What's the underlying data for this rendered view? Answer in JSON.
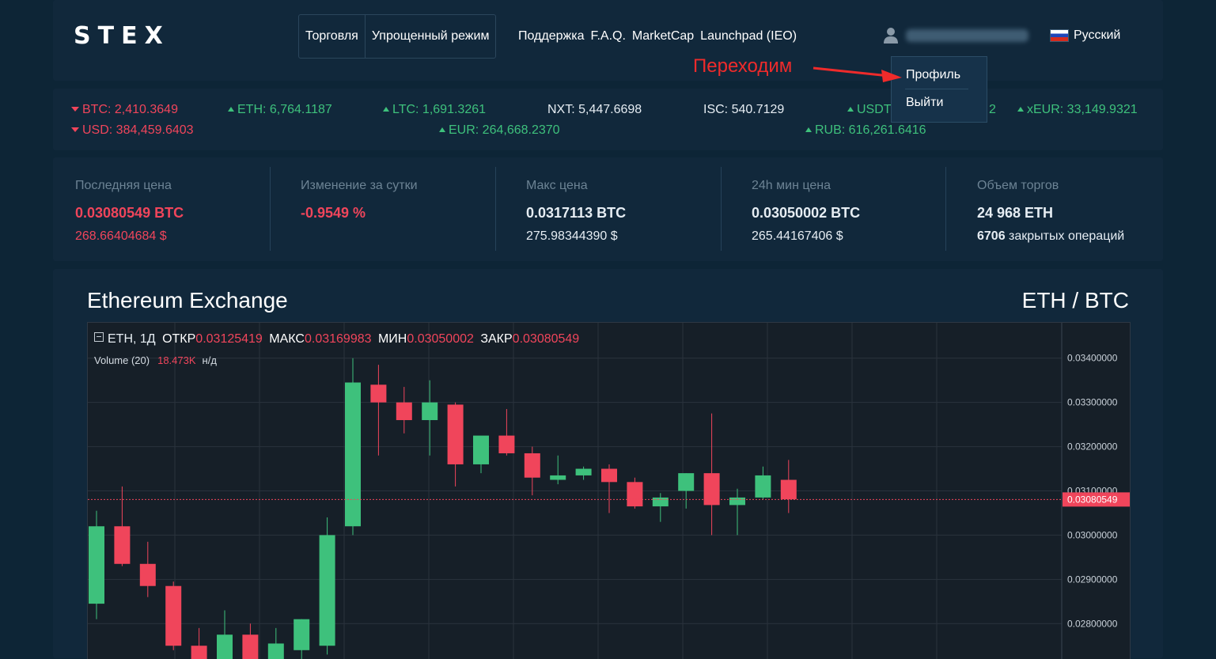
{
  "header": {
    "logo": "STEX",
    "nav_box": [
      "Торговля",
      "Упрощенный режим"
    ],
    "nav_links": [
      "Поддержка",
      "F.A.Q.",
      "MarketCap",
      "Launchpad (IEO)"
    ],
    "language": "Русский",
    "user_menu": {
      "profile": "Профиль",
      "logout": "Выйти"
    }
  },
  "annotation": "Переходим",
  "annotation_color": "#ef2b2b",
  "ticker": {
    "btc": "BTC: 2,410.3649",
    "usd": "USD: 384,459.6403",
    "eth": "ETH: 6,764.1187",
    "ltc": "LTC: 1,691.3261",
    "eur": "EUR: 264,668.2370",
    "nxt": "NXT: 5,447.6698",
    "isc": "ISC: 540.7129",
    "usdt": "USDT",
    "usdt_tail": "2",
    "rub": "RUB: 616,261.6416",
    "xeur": "xEUR: 33,149.9321"
  },
  "stats": [
    {
      "label": "Последняя цена",
      "value": "0.03080549 BTC",
      "sub": "268.66404684 $"
    },
    {
      "label": "Изменение за сутки",
      "value": "-0.9549 %",
      "sub": ""
    },
    {
      "label": "Макс цена",
      "value": "0.0317113 BTC",
      "sub": "275.98344390 $"
    },
    {
      "label": "24h мин цена",
      "value": "0.03050002 BTC",
      "sub": "265.44167406 $"
    },
    {
      "label": "Объем торгов",
      "value": "24 968 ETH",
      "sub_num": "6706",
      "sub_text": " закрытых операций"
    }
  ],
  "chart_panel": {
    "title": "Ethereum Exchange",
    "pair": "ETH / BTC"
  },
  "colors": {
    "up": "#3ec17c",
    "down": "#f0455b",
    "background": "#0d2536",
    "panel": "#11283b",
    "chart_bg": "#161f28"
  },
  "chart_data": {
    "type": "candlestick",
    "symbol": "ETH, 1Д",
    "ohlc_labels": {
      "open": "ОТКР",
      "high": "МАКС",
      "low": "МИН",
      "close": "ЗАКР"
    },
    "ohlc_values": {
      "open": "0.03125419",
      "high": "0.03169983",
      "low": "0.03050002",
      "close": "0.03080549"
    },
    "volume_label": "Volume (20)",
    "volume_value": "18.473K",
    "volume_na": "н/д",
    "y_ticks": [
      "0.03400000",
      "0.03300000",
      "0.03200000",
      "0.03100000",
      "0.03000000",
      "0.02900000",
      "0.02800000"
    ],
    "y_range": [
      0.0272,
      0.0348
    ],
    "last_price": 0.03080549,
    "last_price_label": "0.03080549",
    "candles": [
      {
        "o": 0.02845,
        "h": 0.03055,
        "l": 0.0281,
        "c": 0.0302
      },
      {
        "o": 0.0302,
        "h": 0.0311,
        "l": 0.0293,
        "c": 0.02935
      },
      {
        "o": 0.02935,
        "h": 0.02985,
        "l": 0.0286,
        "c": 0.02885
      },
      {
        "o": 0.02885,
        "h": 0.02895,
        "l": 0.0274,
        "c": 0.0275
      },
      {
        "o": 0.0275,
        "h": 0.0279,
        "l": 0.027,
        "c": 0.02715
      },
      {
        "o": 0.02715,
        "h": 0.0283,
        "l": 0.0269,
        "c": 0.02775
      },
      {
        "o": 0.02775,
        "h": 0.028,
        "l": 0.0272,
        "c": 0.0272
      },
      {
        "o": 0.0272,
        "h": 0.0279,
        "l": 0.0268,
        "c": 0.02755
      },
      {
        "o": 0.0274,
        "h": 0.0281,
        "l": 0.0272,
        "c": 0.0281
      },
      {
        "o": 0.0275,
        "h": 0.0304,
        "l": 0.0273,
        "c": 0.03
      },
      {
        "o": 0.0302,
        "h": 0.034,
        "l": 0.03,
        "c": 0.03345
      },
      {
        "o": 0.0334,
        "h": 0.03385,
        "l": 0.0318,
        "c": 0.033
      },
      {
        "o": 0.033,
        "h": 0.03335,
        "l": 0.0323,
        "c": 0.0326
      },
      {
        "o": 0.0326,
        "h": 0.0335,
        "l": 0.0318,
        "c": 0.033
      },
      {
        "o": 0.03295,
        "h": 0.033,
        "l": 0.0311,
        "c": 0.0316
      },
      {
        "o": 0.0316,
        "h": 0.0322,
        "l": 0.0314,
        "c": 0.03225
      },
      {
        "o": 0.03225,
        "h": 0.03285,
        "l": 0.0318,
        "c": 0.03185
      },
      {
        "o": 0.03185,
        "h": 0.032,
        "l": 0.0309,
        "c": 0.0313
      },
      {
        "o": 0.03125,
        "h": 0.0318,
        "l": 0.03115,
        "c": 0.03135
      },
      {
        "o": 0.03135,
        "h": 0.03155,
        "l": 0.03125,
        "c": 0.0315
      },
      {
        "o": 0.0315,
        "h": 0.0316,
        "l": 0.0305,
        "c": 0.0312
      },
      {
        "o": 0.0312,
        "h": 0.0313,
        "l": 0.0306,
        "c": 0.03065
      },
      {
        "o": 0.03065,
        "h": 0.03095,
        "l": 0.0303,
        "c": 0.03085
      },
      {
        "o": 0.031,
        "h": 0.0314,
        "l": 0.0306,
        "c": 0.0314
      },
      {
        "o": 0.0314,
        "h": 0.03275,
        "l": 0.03,
        "c": 0.03068
      },
      {
        "o": 0.03068,
        "h": 0.03105,
        "l": 0.03,
        "c": 0.03085
      },
      {
        "o": 0.03085,
        "h": 0.03155,
        "l": 0.0308,
        "c": 0.03135
      },
      {
        "o": 0.03125,
        "h": 0.0317,
        "l": 0.0305,
        "c": 0.03081
      }
    ]
  }
}
